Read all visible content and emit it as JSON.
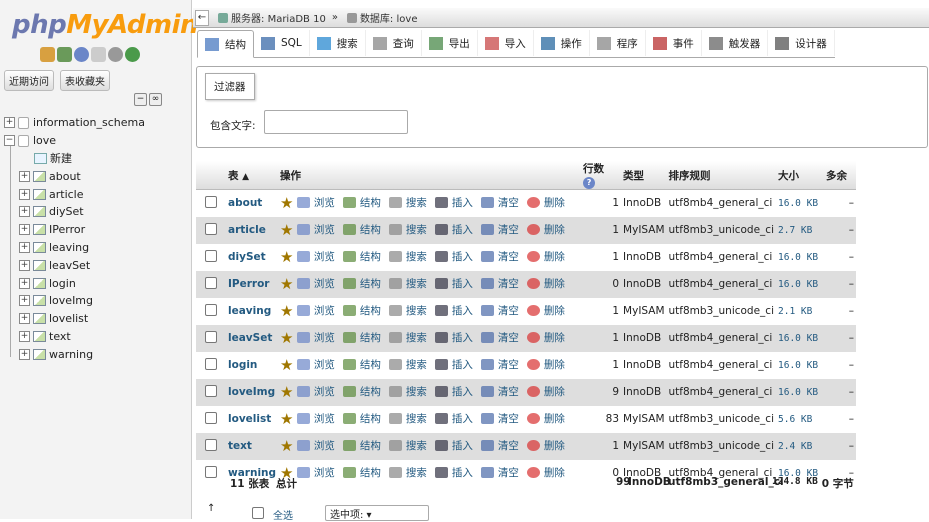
{
  "logo": {
    "php": "php",
    "myadmin": "MyAdmin"
  },
  "left": {
    "recent": "近期访问",
    "favorites": "表收藏夹"
  },
  "tree": {
    "databases": [
      "information_schema",
      "love"
    ],
    "new": "新建",
    "tables": [
      "about",
      "article",
      "diySet",
      "IPerror",
      "leaving",
      "leavSet",
      "login",
      "loveImg",
      "lovelist",
      "text",
      "warning"
    ]
  },
  "breadcrumb": {
    "server_label": "服务器:",
    "server": "MariaDB 10",
    "sep": "»",
    "db_label": "数据库:",
    "db": "love"
  },
  "tabs": [
    "结构",
    "SQL",
    "搜索",
    "查询",
    "导出",
    "导入",
    "操作",
    "程序",
    "事件",
    "触发器",
    "设计器"
  ],
  "filter": {
    "legend": "过滤器",
    "label": "包含文字:"
  },
  "table": {
    "headers": [
      "表",
      "操作",
      "行数",
      "类型",
      "排序规则",
      "大小",
      "多余"
    ],
    "actions": [
      "浏览",
      "结构",
      "搜索",
      "插入",
      "清空",
      "删除"
    ],
    "rows": [
      {
        "name": "about",
        "rows": "1",
        "type": "InnoDB",
        "coll": "utf8mb4_general_ci",
        "size": "16.0",
        "unit": "KB",
        "over": "–"
      },
      {
        "name": "article",
        "rows": "1",
        "type": "MyISAM",
        "coll": "utf8mb3_unicode_ci",
        "size": "2.7",
        "unit": "KB",
        "over": "–"
      },
      {
        "name": "diySet",
        "rows": "1",
        "type": "InnoDB",
        "coll": "utf8mb4_general_ci",
        "size": "16.0",
        "unit": "KB",
        "over": "–"
      },
      {
        "name": "IPerror",
        "rows": "0",
        "type": "InnoDB",
        "coll": "utf8mb4_general_ci",
        "size": "16.0",
        "unit": "KB",
        "over": "–"
      },
      {
        "name": "leaving",
        "rows": "1",
        "type": "MyISAM",
        "coll": "utf8mb3_unicode_ci",
        "size": "2.1",
        "unit": "KB",
        "over": "–"
      },
      {
        "name": "leavSet",
        "rows": "1",
        "type": "InnoDB",
        "coll": "utf8mb4_general_ci",
        "size": "16.0",
        "unit": "KB",
        "over": "–"
      },
      {
        "name": "login",
        "rows": "1",
        "type": "InnoDB",
        "coll": "utf8mb4_general_ci",
        "size": "16.0",
        "unit": "KB",
        "over": "–"
      },
      {
        "name": "loveImg",
        "rows": "9",
        "type": "InnoDB",
        "coll": "utf8mb4_general_ci",
        "size": "16.0",
        "unit": "KB",
        "over": "–"
      },
      {
        "name": "lovelist",
        "rows": "83",
        "type": "MyISAM",
        "coll": "utf8mb3_unicode_ci",
        "size": "5.6",
        "unit": "KB",
        "over": "–"
      },
      {
        "name": "text",
        "rows": "1",
        "type": "MyISAM",
        "coll": "utf8mb3_unicode_ci",
        "size": "2.4",
        "unit": "KB",
        "over": "–"
      },
      {
        "name": "warning",
        "rows": "0",
        "type": "InnoDB",
        "coll": "utf8mb4_general_ci",
        "size": "16.0",
        "unit": "KB",
        "over": "–"
      }
    ]
  },
  "footer": {
    "count": "11 张表",
    "total": "总计",
    "rows": "99",
    "type": "InnoDB",
    "coll": "utf8mb3_general_ci",
    "size": "124.8",
    "unit": "KB",
    "over": "0 字节"
  },
  "bottom": {
    "checkall": "全选",
    "select": "选中项:"
  }
}
